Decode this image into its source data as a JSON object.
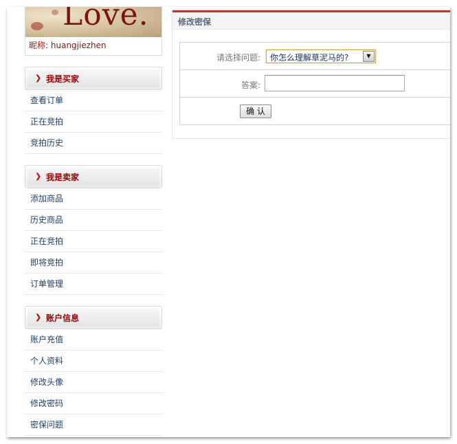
{
  "profile": {
    "avatar_text": "Love.",
    "nickname_label": "昵称:",
    "nickname": "huangjiezhen"
  },
  "buyer": {
    "title": "我是买家",
    "items": [
      "查看订单",
      "正在竞拍",
      "竞拍历史"
    ]
  },
  "seller": {
    "title": "我是卖家",
    "items": [
      "添加商品",
      "历史商品",
      "正在竞拍",
      "即将竞拍",
      "订单管理"
    ]
  },
  "account": {
    "title": "账户信息",
    "items": [
      "账户充值",
      "个人资料",
      "修改头像",
      "修改密码",
      "密保问题"
    ]
  },
  "panel": {
    "title": "修改密保",
    "question_label": "请选择问题:",
    "question_value": "你怎么理解草泥马的?",
    "answer_label": "答案:",
    "answer_value": "",
    "confirm_label": "确 认"
  },
  "colors": {
    "accent_red": "#d92b2b",
    "menu_link": "#1f3f6a",
    "group_title": "#990000"
  },
  "icons": {
    "group_arrow": "chevron-right-icon",
    "select_dropdown": "caret-down-icon"
  }
}
